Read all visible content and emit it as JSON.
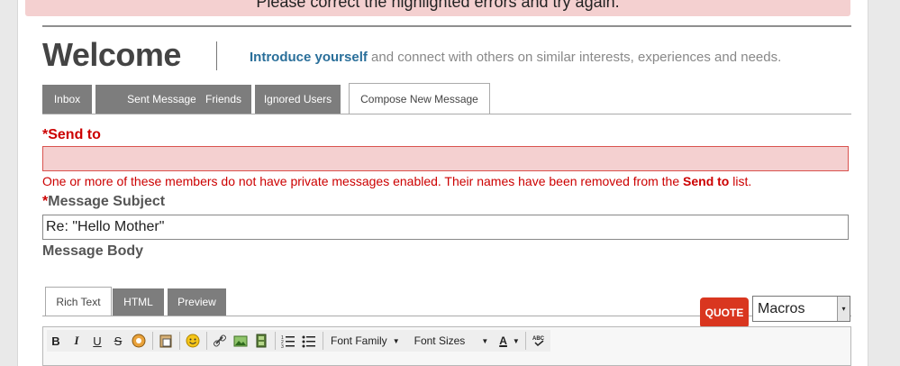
{
  "banner": {
    "text": "Please correct the highlighted errors and try again."
  },
  "header": {
    "title": "Welcome",
    "tagline_link": "Introduce yourself",
    "tagline_rest": " and connect with others on similar interests, experiences and needs."
  },
  "tabs": [
    "Inbox",
    "Sent Messages",
    "Friends",
    "Ignored Users",
    "Compose New Message"
  ],
  "form": {
    "send_to_label": "*Send to",
    "send_to_value": "",
    "send_error_pre": "One or more of these members do not have private messages enabled. Their names have been removed from the ",
    "send_error_bold": "Send to",
    "send_error_post": " list.",
    "subject_required": "*",
    "subject_label": "Message Subject",
    "subject_value": "Re: \"Hello Mother\"",
    "body_label": "Message Body"
  },
  "editor": {
    "tabs": [
      "Rich Text",
      "HTML",
      "Preview"
    ],
    "quote_label": "QUOTE",
    "macros_value": "Macros",
    "font_family_label": "Font Family",
    "font_sizes_label": "Font Sizes",
    "toolbar_icons": [
      "bold-icon",
      "italic-icon",
      "underline-icon",
      "strikethrough-icon",
      "spoiler-icon",
      "paste-icon",
      "emoji-icon",
      "link-icon",
      "image-icon",
      "video-icon",
      "ordered-list-icon",
      "unordered-list-icon",
      "text-color-icon",
      "spellcheck-icon"
    ]
  },
  "colors": {
    "error": "#cc0000",
    "accent_link": "#2a6f9a",
    "quote": "#d9361f"
  }
}
